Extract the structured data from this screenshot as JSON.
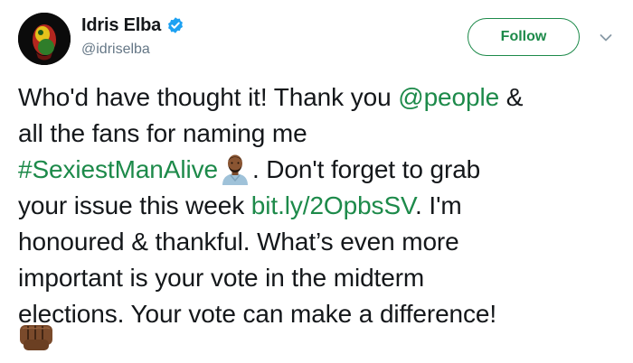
{
  "user": {
    "display_name": "Idris Elba",
    "handle": "@idriselba",
    "verified_icon": "verified-badge-icon",
    "avatar_icon": "profile-avatar"
  },
  "actions": {
    "follow_label": "Follow",
    "more_icon": "chevron-down-icon"
  },
  "tweet": {
    "line1_pre": "Who'd have thought it! Thank you ",
    "mention": "@people",
    "line1_post": " &",
    "line2": "all the fans for naming me",
    "hashtag": "#SexiestManAlive",
    "line3_post": ". Don't forget to grab",
    "line4_pre": "your issue this week ",
    "link": "bit.ly/2OpbsSV",
    "line4_post": ". I'm",
    "line5": "honoured & thankful. What’s even more",
    "line6": "important is your vote in the midterm",
    "line7": "elections. Your vote can make a difference!",
    "emoji_man": "man-medium-dark-skin-emoji",
    "emoji_fist": "oncoming-fist-dark-skin-emoji"
  },
  "colors": {
    "link": "#1d8a4a",
    "text": "#14171a",
    "muted": "#657786",
    "verified": "#1da1f2"
  }
}
